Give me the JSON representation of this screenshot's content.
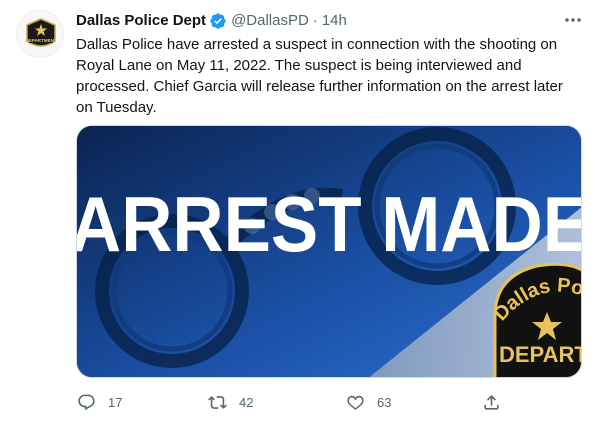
{
  "author": {
    "name": "Dallas Police Dept",
    "handle": "@DallasPD",
    "separator": "·",
    "time": "14h",
    "avatar_text": "DEPARTMENT"
  },
  "tweet": {
    "text": "Dallas Police have arrested a suspect in connection with the shooting on Royal Lane on May 11, 2022. The suspect is being interviewed and processed. Chief Garcia will release further information on the arrest later on Tuesday."
  },
  "media": {
    "headline": "ARREST MADE",
    "badge_top": "Dallas Police",
    "badge_bottom": "DEPARTMENT"
  },
  "actions": {
    "replies": "17",
    "retweets": "42",
    "likes": "63"
  },
  "colors": {
    "verified": "#1d9bf0",
    "muted": "#536471",
    "badge_gold": "#e8c35a"
  },
  "icons": [
    "verified-badge-icon",
    "more-icon",
    "reply-icon",
    "retweet-icon",
    "like-icon",
    "share-icon"
  ]
}
